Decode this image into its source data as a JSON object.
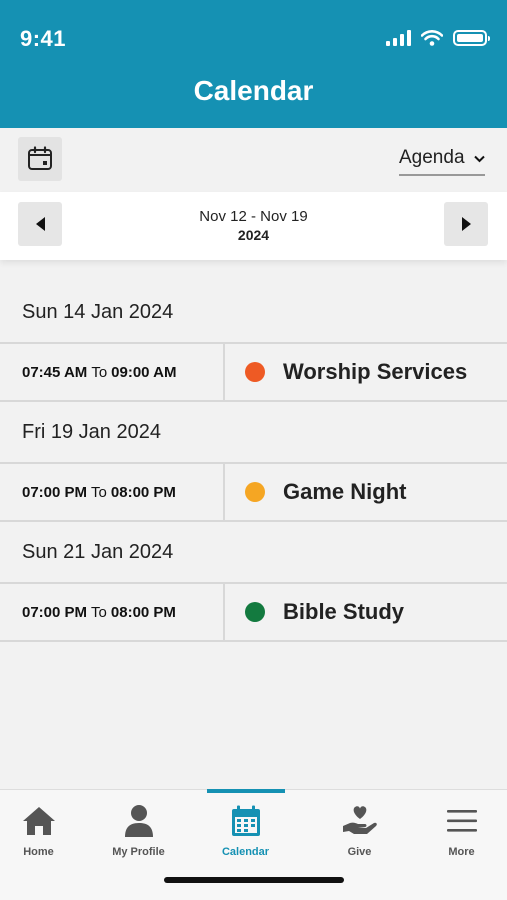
{
  "status_bar": {
    "time": "9:41"
  },
  "header": {
    "title": "Calendar"
  },
  "toolbar": {
    "view_mode": "Agenda"
  },
  "week_nav": {
    "range": "Nov 12 - Nov 19",
    "year": "2024"
  },
  "agenda": {
    "connector": "To",
    "days": [
      {
        "date": "Sun 14 Jan 2024",
        "events": [
          {
            "start": "07:45 AM",
            "end": "09:00 AM",
            "title": "Worship Services",
            "color": "#ee5a24"
          }
        ]
      },
      {
        "date": "Fri 19 Jan 2024",
        "events": [
          {
            "start": "07:00 PM",
            "end": "08:00 PM",
            "title": "Game Night",
            "color": "#f5a623"
          }
        ]
      },
      {
        "date": "Sun 21 Jan 2024",
        "events": [
          {
            "start": "07:00 PM",
            "end": "08:00 PM",
            "title": "Bible Study",
            "color": "#137a3f"
          }
        ]
      }
    ]
  },
  "tabs": [
    {
      "label": "Home",
      "icon": "home-icon"
    },
    {
      "label": "My Profile",
      "icon": "profile-icon"
    },
    {
      "label": "Calendar",
      "icon": "calendar-icon",
      "active": true
    },
    {
      "label": "Give",
      "icon": "give-icon"
    },
    {
      "label": "More",
      "icon": "menu-icon"
    }
  ],
  "colors": {
    "brand": "#1591b3"
  }
}
